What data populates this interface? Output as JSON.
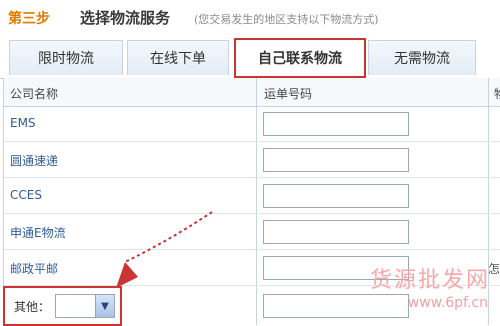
{
  "header": {
    "step": "第三步",
    "title": "选择物流服务",
    "subtitle": "(您交易发生的地区支持以下物流方式)"
  },
  "tabs": [
    {
      "label": "限时物流"
    },
    {
      "label": "在线下单"
    },
    {
      "label": "自己联系物流"
    },
    {
      "label": "无需物流"
    }
  ],
  "table": {
    "headers": [
      "公司名称",
      "运单号码",
      "物"
    ],
    "rows": [
      {
        "name": "EMS",
        "tracking": ""
      },
      {
        "name": "圆通速递",
        "tracking": ""
      },
      {
        "name": "CCES",
        "tracking": ""
      },
      {
        "name": "申通E物流",
        "tracking": ""
      },
      {
        "name": "邮政平邮",
        "tracking": ""
      }
    ],
    "other_label": "其他：",
    "other_select_value": "",
    "row5_extra": "怎"
  },
  "watermark": {
    "text": "货源批发网",
    "url": "www.6pf.cn"
  },
  "colors": {
    "highlight": "#cc3333",
    "step": "#e07a00"
  }
}
